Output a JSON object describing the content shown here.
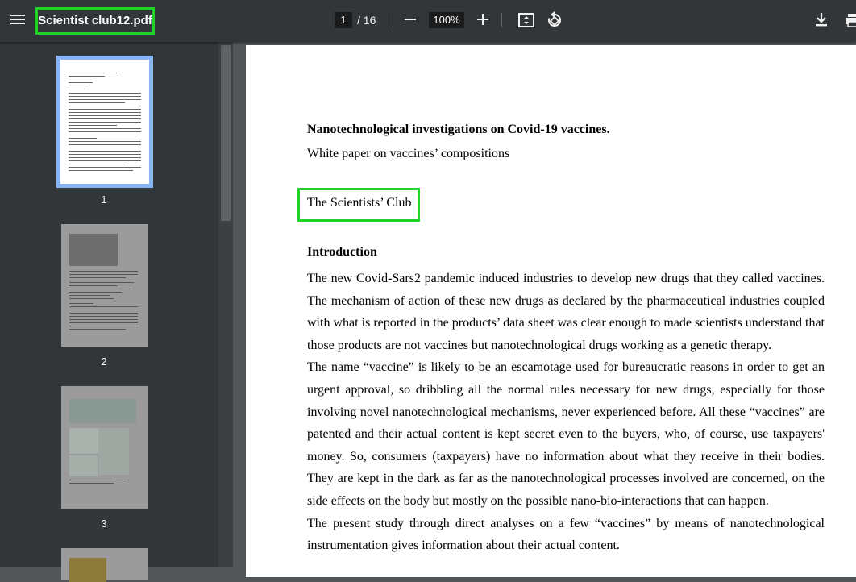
{
  "toolbar": {
    "title": "Scientist club12.pdf",
    "page_current": "1",
    "page_total": "/ 16",
    "zoom": "100%"
  },
  "sidebar": {
    "thumbnails": [
      {
        "page": "1",
        "selected": true
      },
      {
        "page": "2",
        "selected": false
      },
      {
        "page": "3",
        "selected": false
      }
    ]
  },
  "document": {
    "title": "Nanotechnological investigations on Covid-19 vaccines.",
    "subtitle": "White paper on vaccines’ compositions",
    "author": "The Scientists’ Club",
    "heading": "Introduction",
    "paragraphs": [
      "The new Covid-Sars2 pandemic induced industries to develop new drugs that they called vaccines. The mechanism of action of these new drugs as declared by the pharmaceutical industries coupled with what is reported in the products’ data sheet was clear enough to made scientists understand that those products are not vaccines but nanotechnological drugs working as a genetic therapy.",
      "The name “vaccine” is likely to be an escamotage used for bureaucratic reasons in order to get an urgent approval, so dribbling all the normal rules necessary for new drugs, especially for those involving novel nanotechnological mechanisms, never experienced before. All these “vaccines” are patented and their actual content is kept secret even to the buyers, who, of course, use taxpayers' money. So, consumers (taxpayers) have no information about what they receive in their bodies. They are kept in the dark as far as the nanotechnological processes involved are concerned, on the side effects on the body but mostly on the possible nano-bio-interactions that can happen.",
      "The present study through direct analyses on a few “vaccines” by means of nanotechnological instrumentation gives information about their actual content."
    ]
  },
  "colors": {
    "toolbar_bg": "#323639",
    "viewer_bg": "#525659",
    "highlight": "#22d127",
    "selected_thumb_border": "#8ab4f8"
  }
}
